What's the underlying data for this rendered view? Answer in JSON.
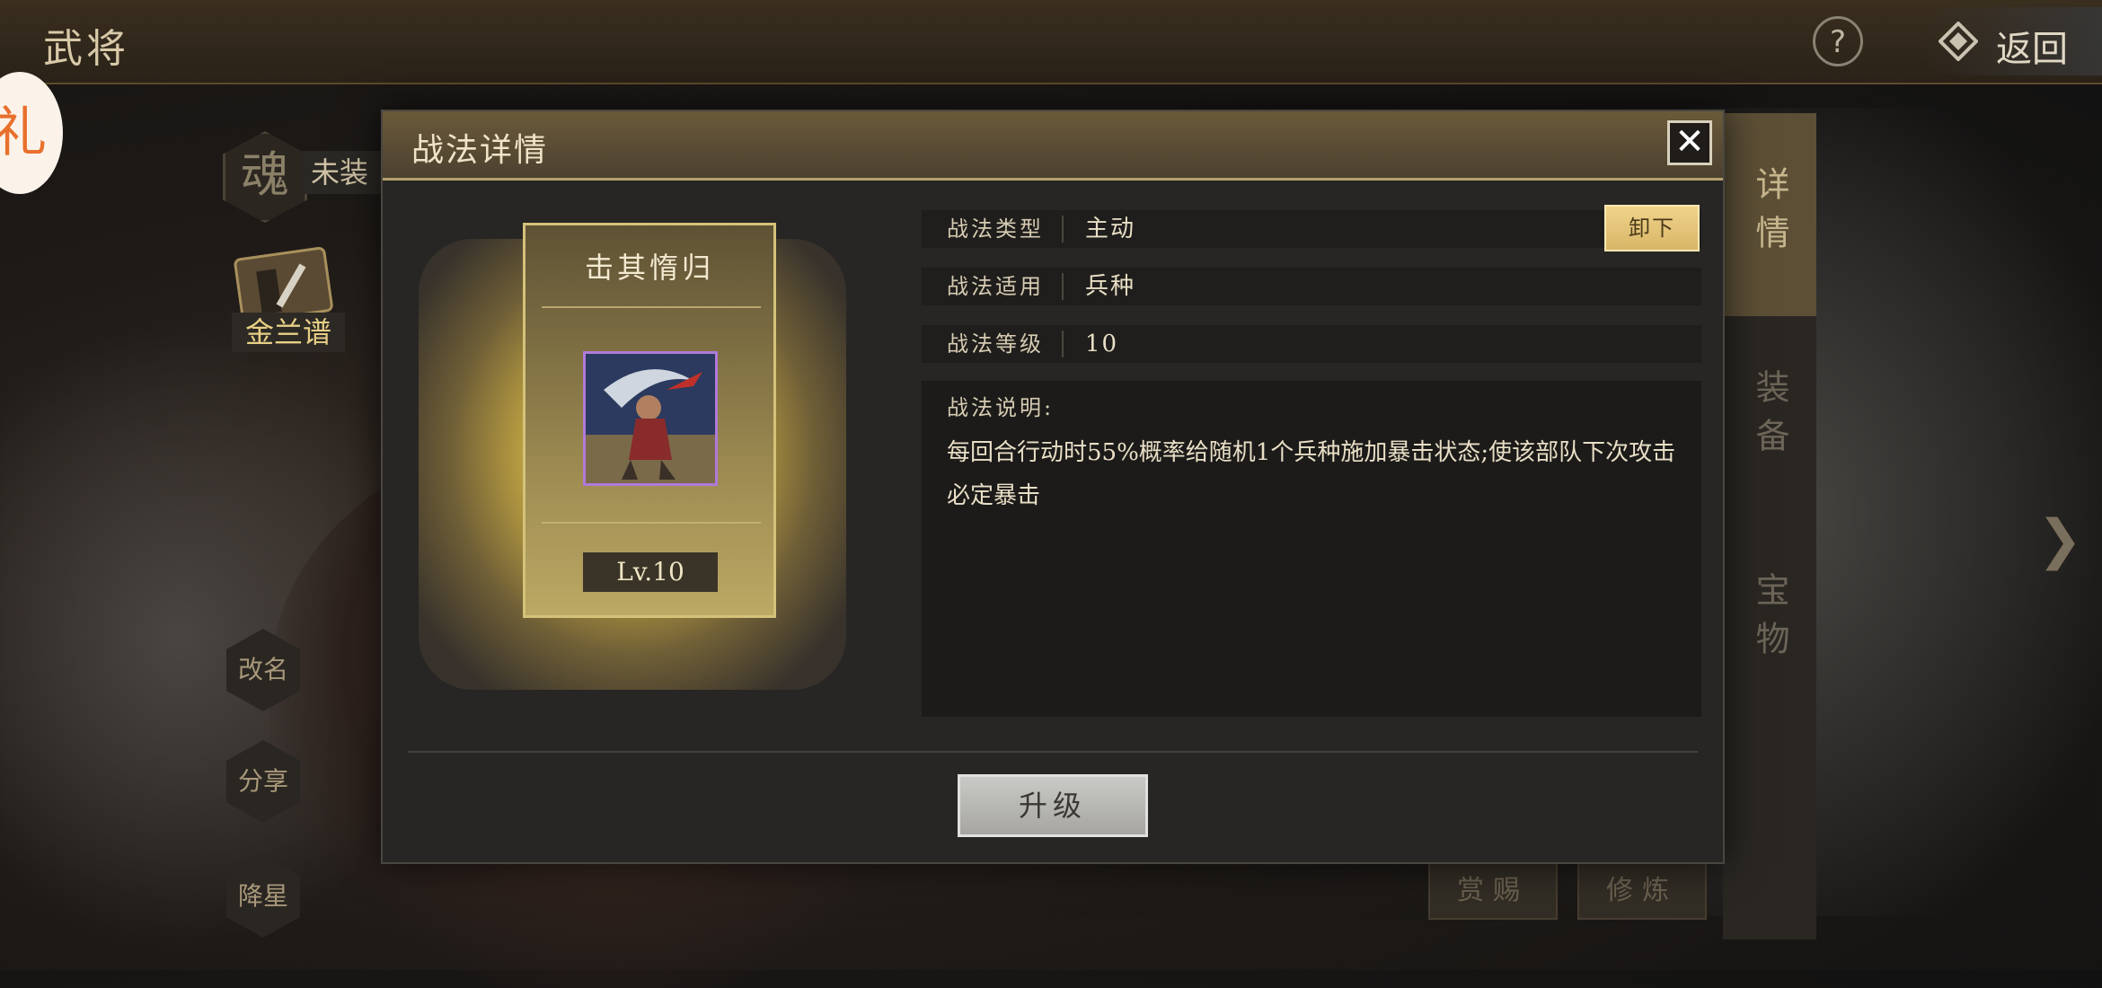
{
  "header": {
    "title": "武将",
    "help_icon": "?",
    "back_label": "返回"
  },
  "left_panel": {
    "gift_icon_char": "礼",
    "soul_char": "魂",
    "soul_status": "未装",
    "book_label": "金兰谱",
    "side_buttons": [
      "改名",
      "分享",
      "降星"
    ]
  },
  "right_tabs": [
    "详情",
    "装备",
    "宝物"
  ],
  "bottom_buttons": [
    "赏赐",
    "修炼"
  ],
  "modal": {
    "title": "战法详情",
    "close_symbol": "✕",
    "card": {
      "skill_name": "击其惰归",
      "level": "Lv.10"
    },
    "info_rows": [
      {
        "key": "战法类型",
        "value": "主动"
      },
      {
        "key": "战法适用",
        "value": "兵种"
      },
      {
        "key": "战法等级",
        "value": "10"
      }
    ],
    "unequip_label": "卸下",
    "description_title": "战法说明:",
    "description_text": "每回合行动时55%概率给随机1个兵种施加暴击状态;使该部队下次攻击必定暴击",
    "upgrade_label": "升级"
  },
  "colors": {
    "accent_gold": "#d8b668",
    "modal_bg": "#282624",
    "portrait_border": "#b07ad8"
  },
  "icons": [
    "help-icon",
    "back-icon",
    "close-icon",
    "gift-icon",
    "book-icon",
    "chevron-right-icon"
  ]
}
